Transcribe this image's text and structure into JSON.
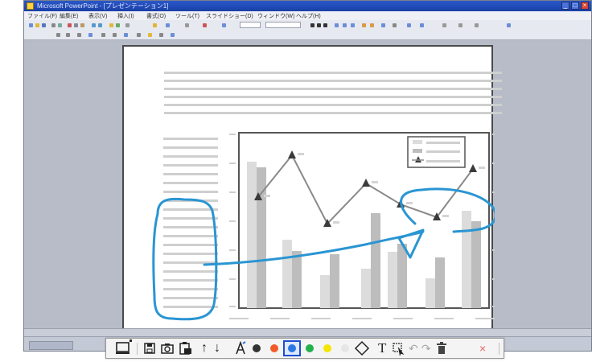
{
  "app": {
    "title": "Microsoft PowerPoint - [プレゼンテーション1]"
  },
  "menu": {
    "items": [
      "ファイル(F)",
      "編集(E)",
      "表示(V)",
      "挿入(I)",
      "書式(O)",
      "ツール(T)",
      "スライドショー(D)",
      "ウィンドウ(W)",
      "ヘルプ(H)"
    ]
  },
  "toolbar": {
    "buttons": [
      {
        "name": "screen-icon",
        "label": "screen"
      },
      {
        "name": "save-icon",
        "label": "save"
      },
      {
        "name": "camera-icon",
        "label": "capture"
      },
      {
        "name": "clipboard-icon",
        "label": "paste"
      },
      {
        "name": "arrow-up-icon",
        "label": "up"
      },
      {
        "name": "arrow-down-icon",
        "label": "down"
      },
      {
        "name": "pen-icon",
        "label": "pen"
      }
    ],
    "pen_colors": [
      "#333333",
      "#f15a29",
      "#2b78e4",
      "#22b24c",
      "#f5e600",
      "#e6e6e6"
    ],
    "selected_color": "#2b78e4",
    "text_tool_label": "T",
    "close_label": "×"
  },
  "colors": {
    "ink": "#2a95d3",
    "bar_light": "#dcdcdc",
    "bar_dark": "#bdbdbd",
    "line": "#8a8a8a",
    "marker": "#3b3b3b"
  }
}
